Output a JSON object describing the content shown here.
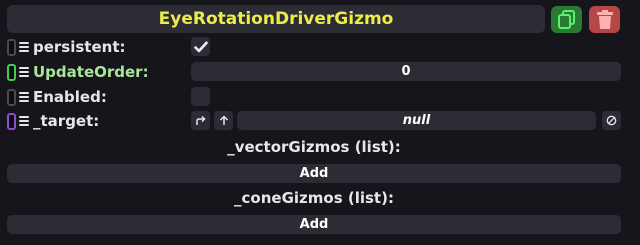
{
  "header": {
    "title": "EyeRotationDriverGizmo",
    "duplicate_icon": "duplicate-icon",
    "delete_icon": "trash-icon"
  },
  "fields": {
    "persistent": {
      "label": "persistent:",
      "checked": true
    },
    "update_order": {
      "label": "UpdateOrder:",
      "value": "0"
    },
    "enabled": {
      "label": "Enabled:",
      "checked": false
    },
    "target": {
      "label": "_target:",
      "value": "null"
    }
  },
  "lists": {
    "vector_gizmos": {
      "header": "_vectorGizmos (list):",
      "add_label": "Add"
    },
    "cone_gizmos": {
      "header": "_coneGizmos (list):",
      "add_label": "Add"
    }
  },
  "colors": {
    "title": "#ecec4a",
    "duplicate_button": "#2a7a36",
    "delete_button": "#b54747",
    "update_order_label": "#a8e69a",
    "handle_green": "#3ccf4a",
    "handle_purple": "#8a4fcf"
  }
}
